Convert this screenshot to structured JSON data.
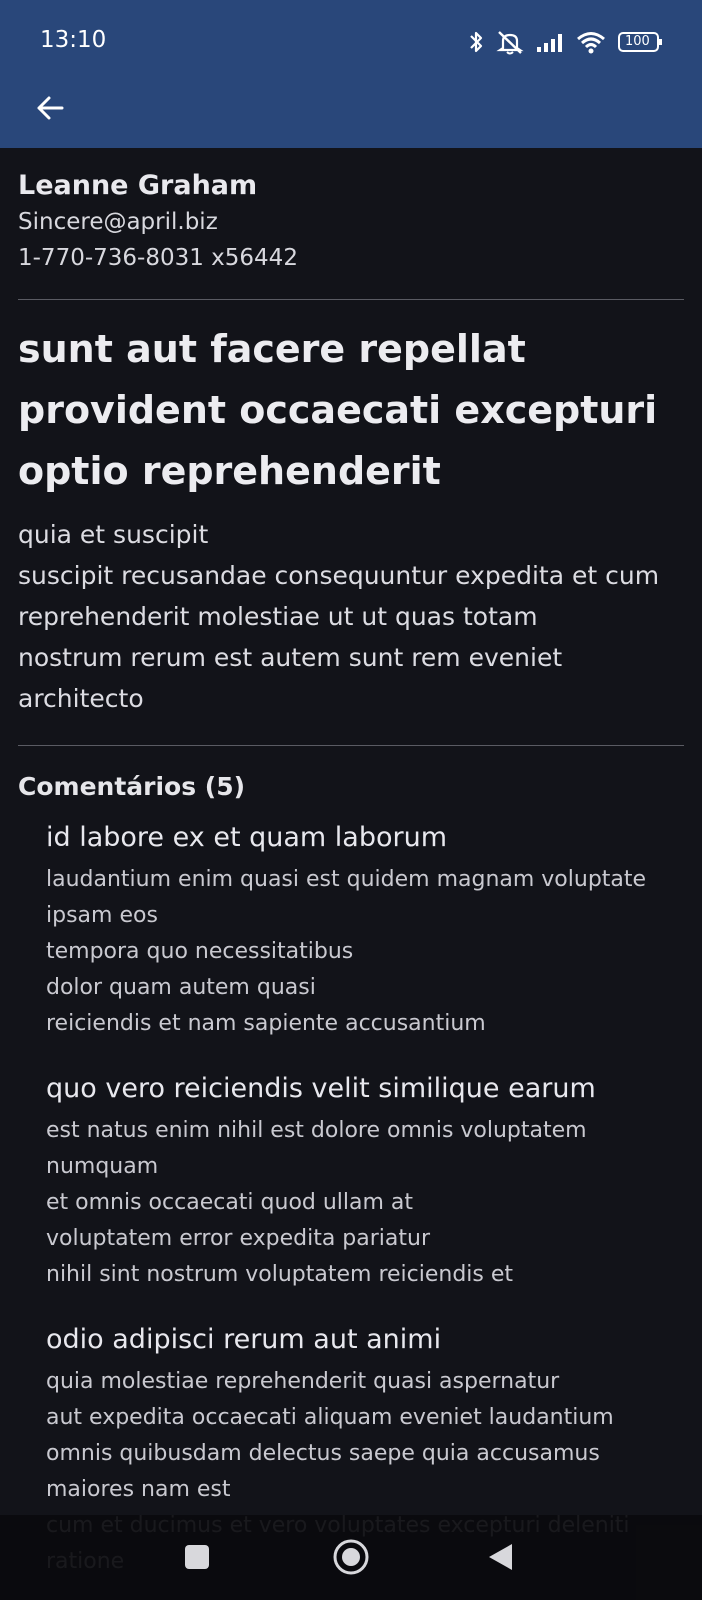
{
  "status_bar": {
    "time": "13:10",
    "battery": "100",
    "icons": [
      "bluetooth-icon",
      "mute-icon",
      "signal-icon",
      "wifi-icon",
      "battery-icon"
    ]
  },
  "toolbar": {
    "back_icon": "arrow-left-icon"
  },
  "author": {
    "name": "Leanne Graham",
    "email": "Sincere@april.biz",
    "phone": "1-770-736-8031 x56442"
  },
  "post": {
    "title": "sunt aut facere repellat provident occaecati excepturi optio reprehenderit",
    "body": "quia et suscipit\nsuscipit recusandae consequuntur expedita et cum reprehenderit molestiae ut ut quas totam\nnostrum rerum est autem sunt rem eveniet architecto"
  },
  "comments": {
    "header": "Comentários (5)",
    "items": [
      {
        "name": "id labore ex et quam laborum",
        "body": "laudantium enim quasi est quidem magnam voluptate ipsam eos\ntempora quo necessitatibus\ndolor quam autem quasi\nreiciendis et nam sapiente accusantium"
      },
      {
        "name": "quo vero reiciendis velit similique earum",
        "body": "est natus enim nihil est dolore omnis voluptatem numquam\net omnis occaecati quod ullam at\nvoluptatem error expedita pariatur\nnihil sint nostrum voluptatem reiciendis et"
      },
      {
        "name": "odio adipisci rerum aut animi",
        "body": "quia molestiae reprehenderit quasi aspernatur\naut expedita occaecati aliquam eveniet laudantium\nomnis quibusdam delectus saepe quia accusamus maiores nam est\ncum et ducimus et vero voluptates excepturi deleniti ratione"
      }
    ]
  },
  "nav_bar": {
    "icons": [
      "recents-square-icon",
      "home-circle-icon",
      "back-triangle-icon"
    ]
  },
  "colors": {
    "app_bar": "#29477a",
    "background": "#121319",
    "divider": "#5a5b63"
  }
}
